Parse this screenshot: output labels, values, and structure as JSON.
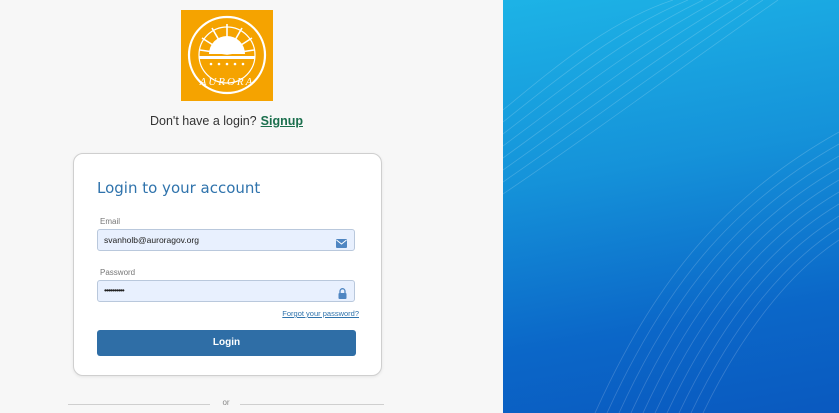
{
  "signup": {
    "prompt": "Don't have a login?",
    "link": "Signup"
  },
  "logo": {
    "text": "AURORA",
    "icon": "aurora-sun-logo",
    "bg_color": "#f5a300"
  },
  "login_card": {
    "title": "Login to your account",
    "email": {
      "label": "Email",
      "value": "svanholb@auroragov.org",
      "icon": "envelope-icon"
    },
    "password": {
      "label": "Password",
      "value": "••••••••••",
      "icon": "lock-icon"
    },
    "forgot_link": "Forgot your password?",
    "login_button": "Login"
  },
  "divider": {
    "text": "or"
  },
  "colors": {
    "accent": "#2f6ea6",
    "title": "#2f73ac",
    "signup_link": "#1b6f4d",
    "input_bg": "#e8f0fe",
    "panel_blue": "#1592d9"
  }
}
